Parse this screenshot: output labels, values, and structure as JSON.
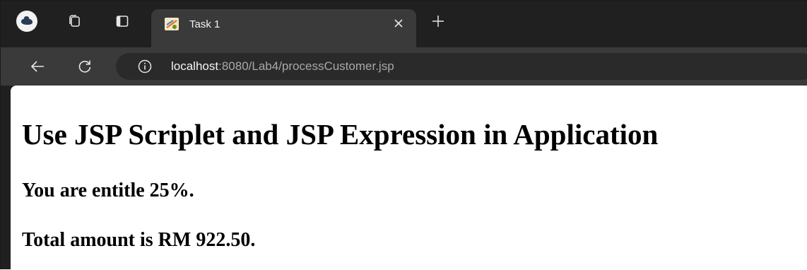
{
  "browser": {
    "tab": {
      "title": "Task 1",
      "favicon": "jsp-cup-icon"
    },
    "address_bar": {
      "host": "localhost",
      "rest": ":8080/Lab4/processCustomer.jsp"
    },
    "icons": {
      "profile": "profile-avatar-icon",
      "workspaces": "workspaces-icon",
      "tab_actions": "tab-actions-icon",
      "close": "close-icon",
      "new_tab": "plus-icon",
      "back": "back-arrow-icon",
      "refresh": "refresh-icon",
      "info": "info-icon"
    },
    "colors": {
      "tabstrip": "#202020",
      "toolbar": "#3a3a3a",
      "omnibox": "#2a2a2a"
    }
  },
  "page": {
    "heading": "Use JSP Scriplet and JSP Expression in Application",
    "discount_text": "You are entitle 25%.",
    "total_text": "Total amount is RM 922.50."
  }
}
